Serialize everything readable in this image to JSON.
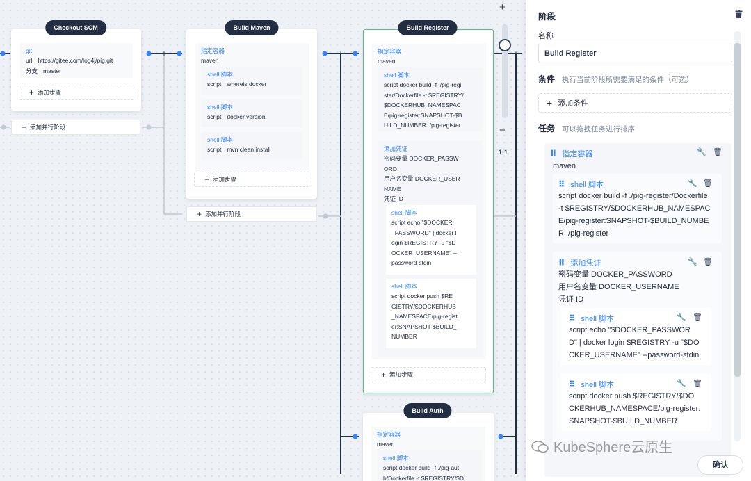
{
  "stages": {
    "checkout": {
      "title": "Checkout SCM",
      "git_label": "git",
      "url_key": "url",
      "url_value": "https://gitee.com/log4j/pig.git",
      "branch_key": "分支",
      "branch_value": "master",
      "add_step": "添加步骤"
    },
    "maven": {
      "title": "Build Maven",
      "container_label": "指定容器",
      "container_value": "maven",
      "steps": [
        {
          "label": "shell 脚本",
          "key": "script",
          "value": "whereis docker"
        },
        {
          "label": "shell 脚本",
          "key": "script",
          "value": "docker version"
        },
        {
          "label": "shell 脚本",
          "key": "script",
          "value": "mvn clean install"
        }
      ],
      "add_step": "添加步骤"
    },
    "register": {
      "title": "Build Register",
      "container_label": "指定容器",
      "container_value": "maven",
      "shell_label": "shell 脚本",
      "shell_lines": [
        "script   docker build -f ./pig-regi",
        "ster/Dockerfile -t $REGISTRY/",
        "$DOCKERHUB_NAMESPAC",
        "E/pig-register:SNAPSHOT-$B",
        "UILD_NUMBER ./pig-register"
      ],
      "cred_label": "添加凭证",
      "cred_lines": [
        "密码变量   DOCKER_PASSW",
        "ORD",
        "用户名变量   DOCKER_USER",
        "NAME",
        "凭证 ID"
      ],
      "sub1_label": "shell 脚本",
      "sub1_lines": [
        "script   echo \"$DOCKER",
        "_PASSWORD\" | docker l",
        "ogin $REGISTRY -u \"$D",
        "OCKER_USERNAME\" --",
        "password-stdin"
      ],
      "sub2_label": "shell 脚本",
      "sub2_lines": [
        "script   docker push $RE",
        "GISTRY/$DOCKERHUB",
        "_NAMESPACE/pig-regist",
        "er:SNAPSHOT-$BUILD_",
        "NUMBER"
      ],
      "add_step": "添加步骤"
    },
    "auth": {
      "title": "Build Auth",
      "container_label": "指定容器",
      "container_value": "maven",
      "shell_label": "shell 脚本",
      "shell_lines": [
        "script   docker build -f ./pig-aut",
        "h/Dockerfile -t $REGISTRY/$D"
      ]
    }
  },
  "add_parallel": "添加并行阶段",
  "zoom": {
    "plus": "+",
    "minus": "−",
    "ratio": "1:1"
  },
  "panel": {
    "title": "阶段",
    "name_label": "名称",
    "name_value": "Build Register",
    "condition_title": "条件",
    "condition_desc": "执行当前阶段所需要满足的条件（可选）",
    "add_condition": "添加条件",
    "tasks_title": "任务",
    "tasks_desc": "可以拖拽任务进行排序",
    "container_label": "指定容器",
    "container_value": "maven",
    "shell1_label": "shell 脚本",
    "shell1_lines": [
      "script   docker build -f ./pig-register/Dockerfile",
      "-t $REGISTRY/$DOCKERHUB_NAMESPAC",
      "E/pig-register:SNAPSHOT-$BUILD_NUMBE",
      "R ./pig-register"
    ],
    "cred_label": "添加凭证",
    "cred_lines": [
      "密码变量   DOCKER_PASSWORD",
      "用户名变量   DOCKER_USERNAME",
      "凭证 ID"
    ],
    "sub1_label": "shell 脚本",
    "sub1_lines": [
      "script   echo \"$DOCKER_PASSWOR",
      "D\" | docker login $REGISTRY -u \"$DO",
      "CKER_USERNAME\" --password-stdin"
    ],
    "sub2_label": "shell 脚本",
    "sub2_lines": [
      "script   docker push $REGISTRY/$DO",
      "CKERHUB_NAMESPACE/pig-register:",
      "SNAPSHOT-$BUILD_NUMBER"
    ],
    "confirm": "确认"
  },
  "watermark": "KubeSphere云原生",
  "colors": {
    "accent": "#3385ff",
    "dark": "#242e42",
    "active_border": "#55bc8a"
  }
}
